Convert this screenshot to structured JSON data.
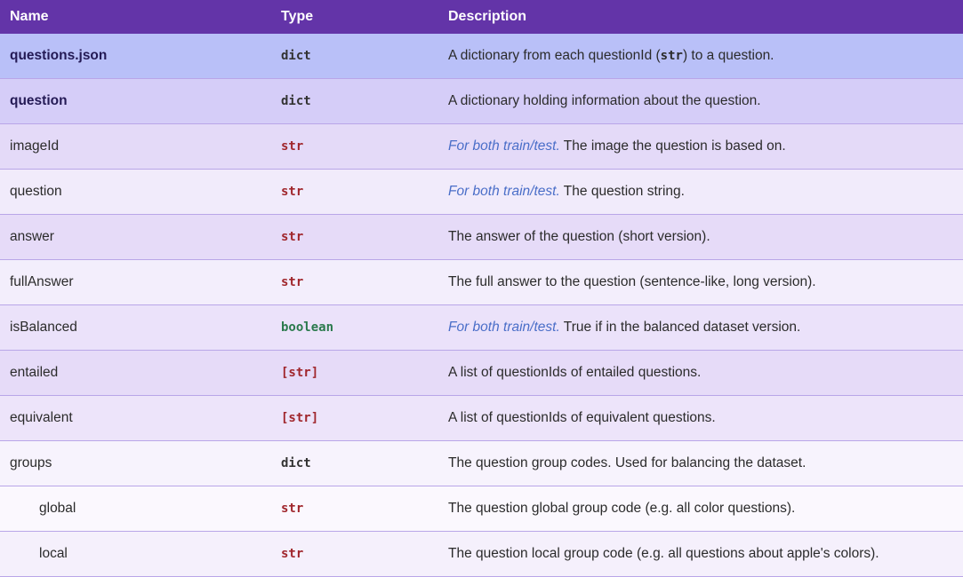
{
  "header": {
    "name": "Name",
    "type": "Type",
    "description": "Description"
  },
  "colors": {
    "header_bg": "#6334a8",
    "type_str": "#a0262c",
    "type_boolean": "#2b7a4d",
    "italic_prefix": "#4a6ec8"
  },
  "rows": [
    {
      "name": "questions.json",
      "type": "dict",
      "desc_prefix": "",
      "desc_before": "A dictionary from each questionId (",
      "desc_code": "str",
      "desc_after": ") to a question.",
      "bg": "#b9c0f8"
    },
    {
      "name": "question",
      "type": "dict",
      "desc_prefix": "",
      "desc_before": "A dictionary holding information about the question.",
      "desc_code": "",
      "desc_after": "",
      "bg": "#d5cdf8"
    },
    {
      "name": "imageId",
      "type": "str",
      "desc_prefix": "For both train/test.",
      "desc_before": " The image the question is based on.",
      "desc_code": "",
      "desc_after": "",
      "bg": "#e4daf8"
    },
    {
      "name": "question",
      "type": "str",
      "desc_prefix": "For both train/test.",
      "desc_before": " The question string.",
      "desc_code": "",
      "desc_after": "",
      "bg": "#f1ebfb"
    },
    {
      "name": "answer",
      "type": "str",
      "desc_prefix": "",
      "desc_before": "The answer of the question (short version).",
      "desc_code": "",
      "desc_after": "",
      "bg": "#e6dbf8"
    },
    {
      "name": "fullAnswer",
      "type": "str",
      "desc_prefix": "",
      "desc_before": "The full answer to the question (sentence-like, long version).",
      "desc_code": "",
      "desc_after": "",
      "bg": "#f3eefc"
    },
    {
      "name": "isBalanced",
      "type": "boolean",
      "desc_prefix": "For both train/test.",
      "desc_before": " True if in the balanced dataset version.",
      "desc_code": "",
      "desc_after": "",
      "bg": "#ebe2fa"
    },
    {
      "name": "entailed",
      "type": "[str]",
      "desc_prefix": "",
      "desc_before": "A list of questionIds of entailed questions.",
      "desc_code": "",
      "desc_after": "",
      "bg": "#e6dbf8"
    },
    {
      "name": "equivalent",
      "type": "[str]",
      "desc_prefix": "",
      "desc_before": "A list of questionIds of equivalent questions.",
      "desc_code": "",
      "desc_after": "",
      "bg": "#ede4fa"
    },
    {
      "name": "groups",
      "type": "dict",
      "desc_prefix": "",
      "desc_before": "The question group codes. Used for balancing the dataset.",
      "desc_code": "",
      "desc_after": "",
      "bg": "#f7f3fd"
    },
    {
      "name": "global",
      "type": "str",
      "desc_prefix": "",
      "desc_before": "The question global group code (e.g. all color questions).",
      "desc_code": "",
      "desc_after": "",
      "bg": "#fbf8fe",
      "indent": true
    },
    {
      "name": "local",
      "type": "str",
      "desc_prefix": "",
      "desc_before": "The question local group code (e.g. all questions about apple's colors).",
      "desc_code": "",
      "desc_after": "",
      "bg": "#f5f0fc",
      "indent": true
    }
  ]
}
